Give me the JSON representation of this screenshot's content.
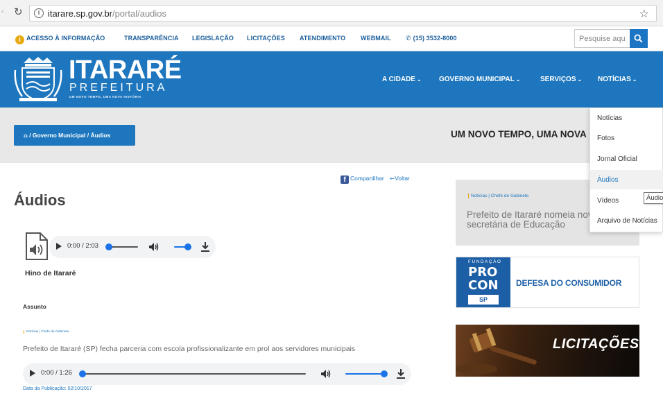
{
  "browser": {
    "url_domain": "itarare.sp.gov.br",
    "url_path": "/portal/audios"
  },
  "top_links": [
    {
      "label": "ACESSO À INFORMAÇÃO"
    },
    {
      "label": "TRANSPARÊNCIA"
    },
    {
      "label": "LEGISLAÇÃO"
    },
    {
      "label": "LICITAÇÕES"
    },
    {
      "label": "ATENDIMENTO"
    },
    {
      "label": "WEBMAIL"
    },
    {
      "label": "(15) 3532-8000"
    }
  ],
  "search": {
    "placeholder": "Pesquise aqui"
  },
  "brand": {
    "name": "ITARARÉ",
    "sub": "PREFEITURA",
    "slogan": "UM NOVO TEMPO, UMA NOVA HISTÓRIA"
  },
  "main_nav": [
    {
      "label": "A CIDADE"
    },
    {
      "label": "GOVERNO MUNICIPAL"
    },
    {
      "label": "SERVIÇOS"
    },
    {
      "label": "NOTÍCIAS"
    }
  ],
  "breadcrumb": {
    "sep": "/",
    "level1": "Governo Municipal",
    "level2": "Áudios"
  },
  "strip_slogan": "UM NOVO TEMPO, UMA NOVA",
  "dropdown": [
    {
      "label": "Notícias"
    },
    {
      "label": "Fotos"
    },
    {
      "label": "Jornal Oficial"
    },
    {
      "label": "Áudios"
    },
    {
      "label": "Vídeos"
    },
    {
      "label": "Arquivo de Notícias"
    }
  ],
  "tooltip": "Áudios",
  "share": {
    "share_label": "Compartilhar",
    "back_label": "Voltar"
  },
  "page_title": "Áudios",
  "audio1": {
    "title": "Hino de Itararé",
    "time": "0:00 / 2:03",
    "progress": 0.0,
    "volume": 1.0
  },
  "subject_heading": "Assunto",
  "subject_tag": "Notícias | Chefe de Gabinete",
  "subject_link": "Prefeito de Itararé (SP) fecha parceria com escola profissionalizante em prol aos servidores municipais",
  "audio2": {
    "time": "0:00 / 1:26",
    "progress": 0.0,
    "volume": 1.0
  },
  "pub_date": "Data da Publicação: 02/10/2017",
  "sidebar_news": {
    "tag": "Notícias | Chefe de Gabinete",
    "headline": "Prefeito de Itararé nomeia nova secretária de Educação"
  },
  "procon": {
    "fund": "FUNDAÇÃO",
    "pro": "PRO",
    "con": "CON",
    "sp": "SP",
    "text": "DEFESA DO CONSUMIDOR"
  },
  "licitacoes_banner": "LICITAÇÕES",
  "colors": {
    "brand_blue": "#1e77be",
    "accent_orange": "#e6a20a",
    "media_blue": "#1a73e8"
  }
}
